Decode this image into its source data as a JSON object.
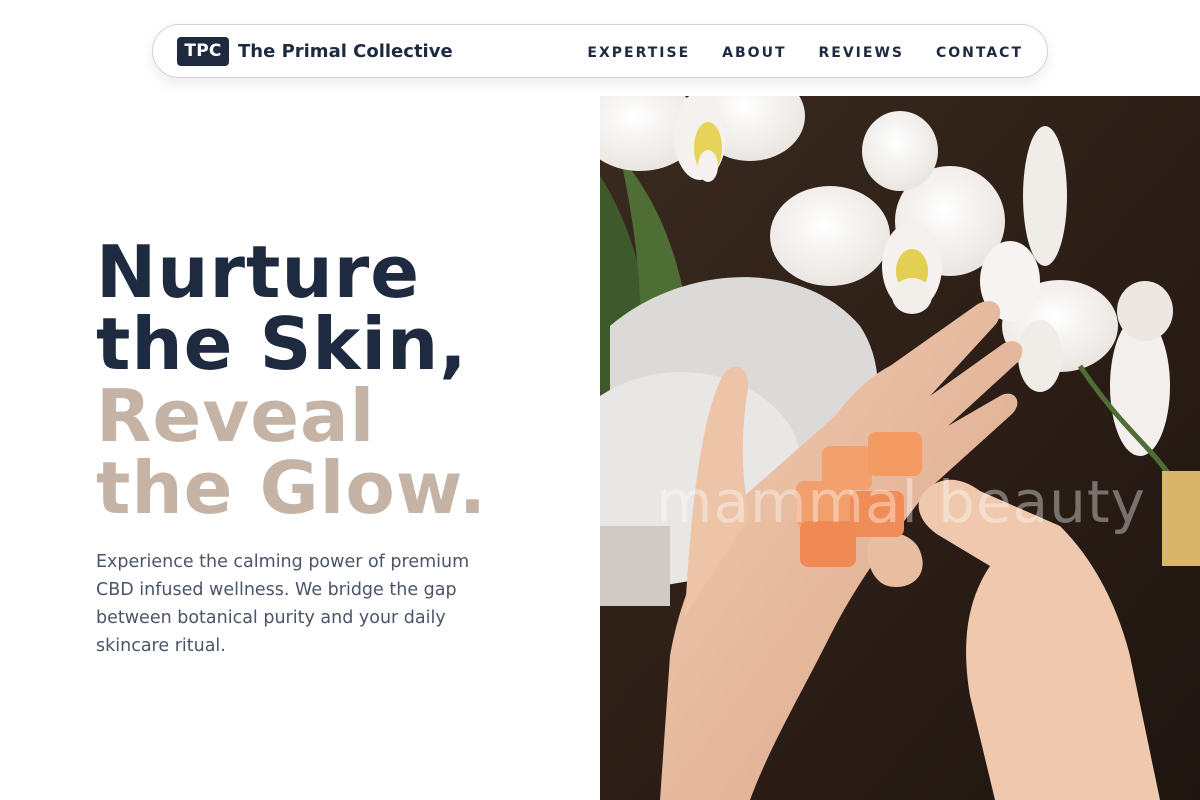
{
  "brand": {
    "badge": "TPC",
    "name": "The Primal Collective"
  },
  "nav": {
    "items": [
      {
        "label": "EXPERTISE"
      },
      {
        "label": "ABOUT"
      },
      {
        "label": "REVIEWS"
      },
      {
        "label": "CONTACT"
      }
    ]
  },
  "hero": {
    "title_lines": [
      {
        "text": "Nurture",
        "tone": "dark"
      },
      {
        "text": "the Skin,",
        "tone": "dark"
      },
      {
        "text": "Reveal",
        "tone": "light"
      },
      {
        "text": "the Glow.",
        "tone": "light"
      }
    ],
    "description": "Experience the calming power of premium CBD infused wellness. We bridge the gap between botanical purity and your daily skincare ritual.",
    "image_watermark": "mammal beauty"
  },
  "colors": {
    "navy": "#1e2a3f",
    "taupe": "#c5b4a5",
    "body_text": "#4a5568"
  }
}
